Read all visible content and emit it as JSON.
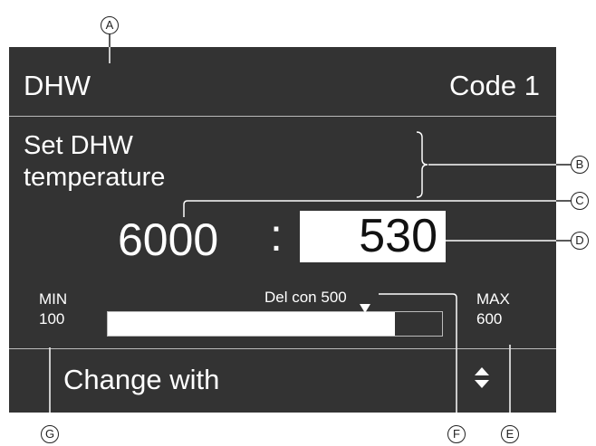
{
  "header": {
    "title": "DHW",
    "code": "Code 1"
  },
  "parameter": {
    "line1": "Set DHW",
    "line2": "temperature"
  },
  "address": {
    "code": "6000",
    "separator": ":",
    "value": "530"
  },
  "range": {
    "min_label": "MIN",
    "min_value": "100",
    "max_label": "MAX",
    "max_value": "600",
    "delivery_label": "Del con 500",
    "level": 0.86
  },
  "footer": {
    "label": "Change with",
    "icon": "up-down-arrows-icon"
  },
  "callouts": [
    "A",
    "B",
    "C",
    "D",
    "E",
    "F",
    "G"
  ],
  "colors": {
    "screen": "#333333",
    "text": "#ffffff",
    "lines": "#bbbbbb",
    "callout": "#222222"
  }
}
